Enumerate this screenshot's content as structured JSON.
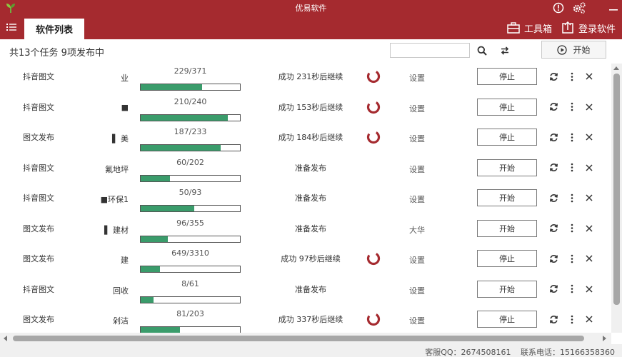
{
  "window": {
    "title": "优易软件",
    "colors": {
      "brand": "#a52a2f",
      "progress": "#3a9c6b",
      "scrollbar": "#a7a7a7"
    }
  },
  "tabs": [
    {
      "label": "软件列表",
      "active": true
    }
  ],
  "toolbar": {
    "toolbox_label": "工具箱",
    "login_label": "登录软件"
  },
  "status": {
    "summary": "共13个任务 9项发布中",
    "search_value": "",
    "start_all_label": "开始"
  },
  "tasks": [
    {
      "type": "抖音图文",
      "name": "业",
      "done": 229,
      "total": 371,
      "count": "229/371",
      "status": "成功 231秒后继续",
      "spinner": true,
      "setting": "设置",
      "action": "停止"
    },
    {
      "type": "抖音图文",
      "name": "■",
      "done": 210,
      "total": 240,
      "count": "210/240",
      "status": "成功 153秒后继续",
      "spinner": true,
      "setting": "设置",
      "action": "停止"
    },
    {
      "type": "图文发布",
      "name": "▌ 美",
      "done": 187,
      "total": 233,
      "count": "187/233",
      "status": "成功 184秒后继续",
      "spinner": true,
      "setting": "设置",
      "action": "停止"
    },
    {
      "type": "抖音图文",
      "name": "氟地坪",
      "done": 60,
      "total": 202,
      "count": "60/202",
      "status": "准备发布",
      "spinner": false,
      "setting": "设置",
      "action": "开始"
    },
    {
      "type": "抖音图文",
      "name": "■环保1",
      "done": 50,
      "total": 93,
      "count": "50/93",
      "status": "准备发布",
      "spinner": false,
      "setting": "设置",
      "action": "开始"
    },
    {
      "type": "图文发布",
      "name": "▌ 建材",
      "done": 96,
      "total": 355,
      "count": "96/355",
      "status": "准备发布",
      "spinner": false,
      "setting": "大华",
      "action": "开始"
    },
    {
      "type": "图文发布",
      "name": "建",
      "done": 649,
      "total": 3310,
      "count": "649/3310",
      "status": "成功 97秒后继续",
      "spinner": true,
      "setting": "设置",
      "action": "停止"
    },
    {
      "type": "抖音图文",
      "name": "回收",
      "done": 8,
      "total": 61,
      "count": "8/61",
      "status": "准备发布",
      "spinner": false,
      "setting": "设置",
      "action": "开始"
    },
    {
      "type": "图文发布",
      "name": "剁洁",
      "done": 81,
      "total": 203,
      "count": "81/203",
      "status": "成功 337秒后继续",
      "spinner": true,
      "setting": "设置",
      "action": "停止"
    }
  ],
  "footer": {
    "qq": "客服QQ：2674508161",
    "phone": "联系电话：15166358360"
  }
}
